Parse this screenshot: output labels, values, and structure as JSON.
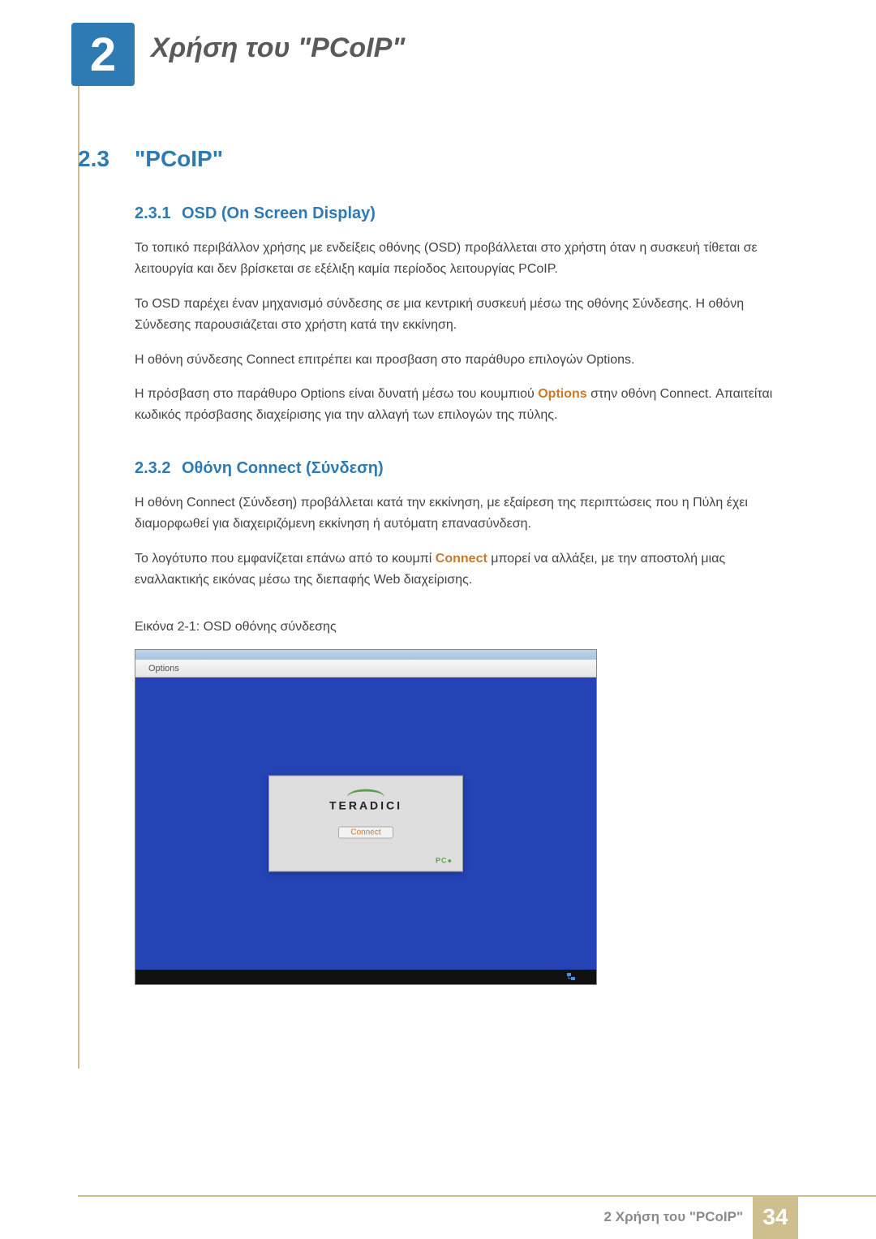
{
  "chapter": {
    "num": "2",
    "title": "Χρήση του \"PCoIP\""
  },
  "section": {
    "num": "2.3",
    "title": "\"PCoIP\""
  },
  "subsections": {
    "s231": {
      "num": "2.3.1",
      "title": "OSD (On Screen Display)",
      "p1": "Το τοπικό περιβάλλον χρήσης με ενδείξεις οθόνης (OSD) προβάλλεται στο χρήστη όταν η συσκευή τίθεται σε λειτουργία και δεν βρίσκεται σε εξέλιξη καμία περίοδος λειτουργίας PCoIP.",
      "p2": "Το OSD παρέχει έναν μηχανισμό σύνδεσης σε μια κεντρική συσκευή μέσω της οθόνης Σύνδεσης. Η οθόνη Σύνδεσης παρουσιάζεται στο χρήστη κατά την εκκίνηση.",
      "p3": "Η οθόνη σύνδεσης Connect επιτρέπει και προσβαση στο παράθυρο επιλογών Options.",
      "p4a": "Η πρόσβαση στο παράθυρο Options είναι δυνατή μέσω του κουμπιού ",
      "p4accent": "Options",
      "p4b": " στην οθόνη Connect. Απαιτείται κωδικός πρόσβασης διαχείρισης για την αλλαγή των επιλογών της πύλης."
    },
    "s232": {
      "num": "2.3.2",
      "title": "Οθόνη Connect (Σύνδεση)",
      "p1": "Η οθόνη Connect (Σύνδεση) προβάλλεται κατά την εκκίνηση, με εξαίρεση της περιπτώσεις που η Πύλη έχει διαμορφωθεί για διαχειριζόμενη εκκίνηση ή αυτόματη επανασύνδεση.",
      "p2a": "Το λογότυπο που εμφανίζεται επάνω από το κουμπί ",
      "p2accent": "Connect",
      "p2b": " μπορεί να αλλάξει, με την αποστολή μιας εναλλακτικής εικόνας μέσω της διεπαφής Web διαχείρισης.",
      "figcaption": "Εικόνα 2-1: OSD οθόνης σύνδεσης"
    }
  },
  "screenshot": {
    "menu_options": "Options",
    "logo_text": "TERADICI",
    "connect_label": "Connect",
    "pcoip_badge": "PC"
  },
  "footer": {
    "text": "2 Χρήση του \"PCoIP\"",
    "page": "34"
  }
}
